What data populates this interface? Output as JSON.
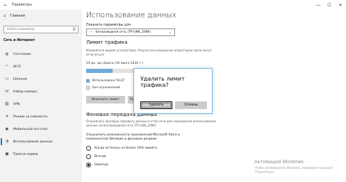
{
  "window": {
    "title": "Параметры",
    "controls": {
      "minimize": "—",
      "maximize": "☐",
      "close": "✕"
    }
  },
  "sidebar": {
    "home_label": "Главная",
    "search_placeholder": "Найти параметр",
    "section_title": "Сеть и Интернет",
    "items": [
      {
        "label": "Состояние",
        "icon": "globe-icon",
        "glyph": "◍"
      },
      {
        "label": "Wi-Fi",
        "icon": "wifi-icon",
        "glyph": "◠"
      },
      {
        "label": "Ethernet",
        "icon": "ethernet-icon",
        "glyph": "▭"
      },
      {
        "label": "Набор номера",
        "icon": "dialup-icon",
        "glyph": "☏"
      },
      {
        "label": "VPN",
        "icon": "vpn-icon",
        "glyph": "⛓"
      },
      {
        "label": "Режим «в самолете»",
        "icon": "airplane-icon",
        "glyph": "✈"
      },
      {
        "label": "Мобильный хот-спот",
        "icon": "hotspot-icon",
        "glyph": "◉"
      },
      {
        "label": "Использование данных",
        "icon": "data-usage-icon",
        "glyph": "◔"
      },
      {
        "label": "Прокси-сервер",
        "icon": "proxy-icon",
        "glyph": "▣"
      }
    ],
    "active_index": 7
  },
  "main": {
    "title": "Использование данных",
    "show_settings_label": "Показать параметры для",
    "network_value": "Беспроводная сеть (TP-LINK_2086)",
    "limit_heading": "Лимит трафика",
    "limit_description": "Измеряется вашим устройством. Результаты измерения оператором связи могут отличаться.",
    "reset_text": "19 дн. до сброса (16 июня 2020 г.)",
    "usage_fraction": 0.3,
    "used_label": "Использовано 56,67",
    "unlimited_label": "Без ограничений",
    "change_limit_button": "Изменить лимит",
    "delete_limit_button": "Уд",
    "background_heading": "Фоновая передача данных",
    "background_description": "Ограничить фоновую передачу данных в этой сети для сокращения использования данных на беспроводной сети (TP-LINK_2086)",
    "restrict_heading_line1": "Ограничить возможности приложений Microsoft Store и",
    "restrict_heading_line2": "компонентов Windows в фоновом режиме",
    "options": [
      "Когда осталось не более 10% лимита",
      "Всегда",
      "Никогда"
    ],
    "selected_option_index": 2
  },
  "watermark": {
    "title": "Активация Windows",
    "text": "Чтобы активировать Windows, перейдите в раздел \"Параметры\"."
  },
  "dialog": {
    "question": "Удалить лимит трафика?",
    "delete_button": "Удалить",
    "cancel_button": "Отмена"
  },
  "colors": {
    "accent": "#0078d7",
    "sidebar_bg": "#f2f2f2",
    "button_bg": "#cccccc",
    "dialog_border": "#6db5e8"
  }
}
